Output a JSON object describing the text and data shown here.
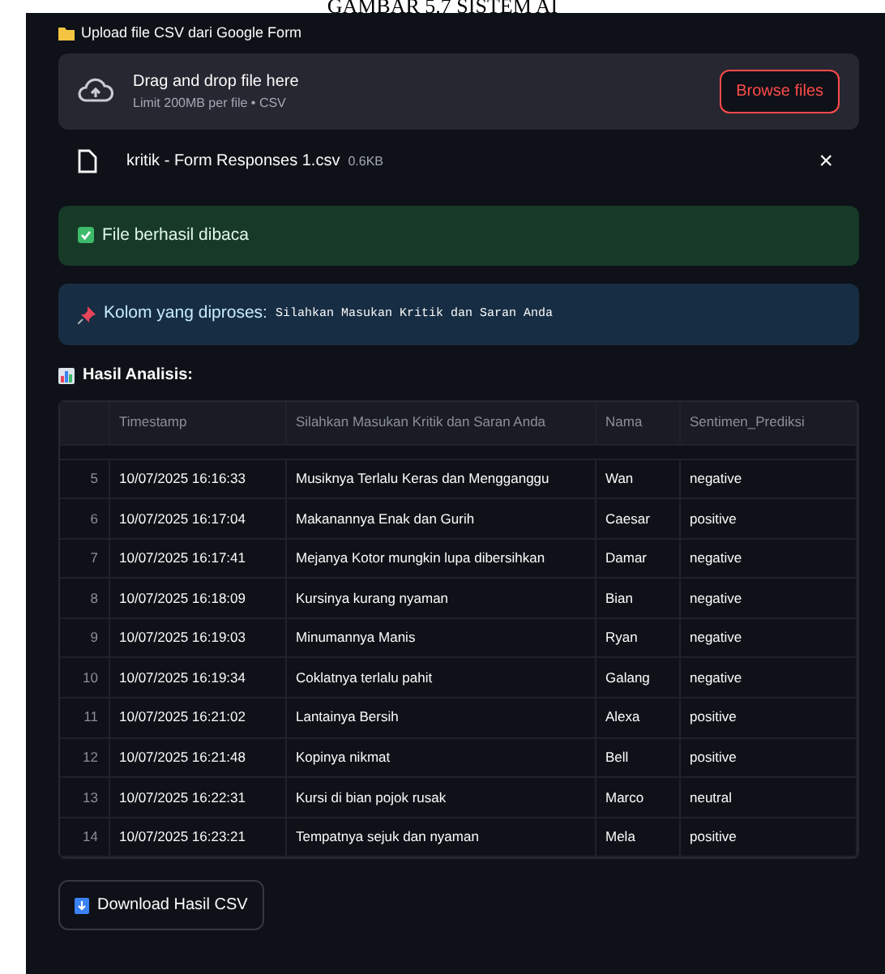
{
  "caption": "GAMBAR 5.7 SISTEM AI",
  "uploader": {
    "label": "Upload file CSV dari Google Form",
    "drop_title": "Drag and drop file here",
    "drop_hint": "Limit 200MB per file • CSV",
    "browse_button": "Browse files",
    "file": {
      "name": "kritik - Form Responses 1.csv",
      "size": "0.6KB",
      "remove": "×"
    }
  },
  "alerts": [
    {
      "kind": "success",
      "text": "File berhasil dibaca"
    },
    {
      "kind": "info",
      "text": "Kolom yang diproses:",
      "code": "Silahkan Masukan Kritik dan Saran Anda"
    }
  ],
  "results_title": "Hasil Analisis:",
  "table": {
    "columns": [
      "Timestamp",
      "Silahkan Masukan Kritik dan Saran Anda",
      "Nama",
      "Sentimen_Prediksi"
    ],
    "rows": [
      {
        "index": "5",
        "cells": [
          "10/07/2025 16:16:33",
          "Musiknya Terlalu Keras dan Mengganggu",
          "Wan",
          "negative"
        ]
      },
      {
        "index": "6",
        "cells": [
          "10/07/2025 16:17:04",
          "Makanannya Enak dan Gurih",
          "Caesar",
          "positive"
        ]
      },
      {
        "index": "7",
        "cells": [
          "10/07/2025 16:17:41",
          "Mejanya Kotor mungkin lupa dibersihkan",
          "Damar",
          "negative"
        ]
      },
      {
        "index": "8",
        "cells": [
          "10/07/2025 16:18:09",
          "Kursinya kurang nyaman",
          "Bian",
          "negative"
        ]
      },
      {
        "index": "9",
        "cells": [
          "10/07/2025 16:19:03",
          "Minumannya Manis",
          "Ryan",
          "negative"
        ]
      },
      {
        "index": "10",
        "cells": [
          "10/07/2025 16:19:34",
          "Coklatnya terlalu pahit",
          "Galang",
          "negative"
        ]
      },
      {
        "index": "11",
        "cells": [
          "10/07/2025 16:21:02",
          "Lantainya Bersih",
          "Alexa",
          "positive"
        ]
      },
      {
        "index": "12",
        "cells": [
          "10/07/2025 16:21:48",
          "Kopinya nikmat",
          "Bell",
          "positive"
        ]
      },
      {
        "index": "13",
        "cells": [
          "10/07/2025 16:22:31",
          "Kursi di bian pojok rusak",
          "Marco",
          "neutral"
        ]
      },
      {
        "index": "14",
        "cells": [
          "10/07/2025 16:23:21",
          "Tempatnya sejuk dan nyaman",
          "Mela",
          "positive"
        ]
      }
    ]
  },
  "download_button": "Download Hasil CSV"
}
